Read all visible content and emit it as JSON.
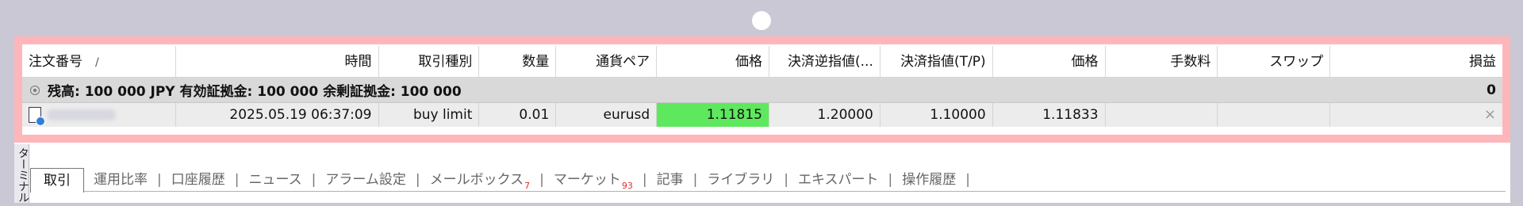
{
  "terminal_tab_label": "ターミナル",
  "columns": {
    "ticket": "注文番号",
    "sort_indicator": "/",
    "time": "時間",
    "type": "取引種別",
    "volume": "数量",
    "symbol": "通貨ペア",
    "price": "価格",
    "sl": "決済逆指値(...",
    "tp": "決済指値(T/P)",
    "price2": "価格",
    "commission": "手数料",
    "swap": "スワップ",
    "profit": "損益"
  },
  "balance_row": {
    "text": "残高: 100 000 JPY  有効証拠金: 100 000  余剰証拠金: 100 000",
    "profit": "0"
  },
  "order_row": {
    "ticket": "",
    "time": "2025.05.19 06:37:09",
    "type": "buy limit",
    "volume": "0.01",
    "symbol": "eurusd",
    "price": "1.11815",
    "sl": "1.20000",
    "tp": "1.10000",
    "current_price": "1.11833",
    "commission": "",
    "swap": "",
    "close_symbol": "×"
  },
  "tabs": [
    {
      "label": "取引",
      "badge": ""
    },
    {
      "label": "運用比率",
      "badge": ""
    },
    {
      "label": "口座履歴",
      "badge": ""
    },
    {
      "label": "ニュース",
      "badge": ""
    },
    {
      "label": "アラーム設定",
      "badge": ""
    },
    {
      "label": "メールボックス",
      "badge": "7"
    },
    {
      "label": "マーケット",
      "badge": "93"
    },
    {
      "label": "記事",
      "badge": ""
    },
    {
      "label": "ライブラリ",
      "badge": ""
    },
    {
      "label": "エキスパート",
      "badge": ""
    },
    {
      "label": "操作履歴",
      "badge": ""
    }
  ],
  "colors": {
    "highlight_border": "#ffb6bb",
    "price_cell_green": "#5ee85e",
    "badge_red": "#e03030"
  }
}
